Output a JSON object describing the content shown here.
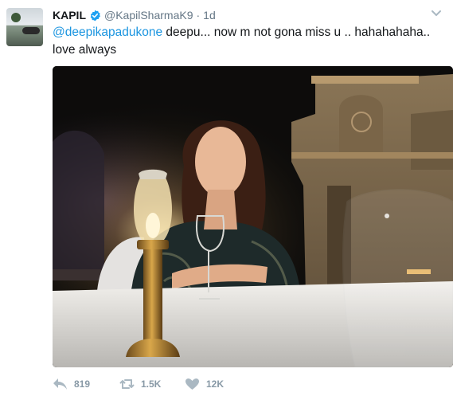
{
  "tweet": {
    "display_name": "KAPIL",
    "handle": "@KapilSharmaK9",
    "separator": "·",
    "time": "1d",
    "mention": "@deepikapadukone",
    "body": " deepu... now m not gona miss u .. hahahahaha.. love always",
    "verified_color": "#1da1f2",
    "link_color": "#1b95e0"
  },
  "actions": {
    "replies": "819",
    "retweets": "1.5K",
    "likes": "12K"
  },
  "icons": {
    "reply": "reply-icon",
    "retweet": "retweet-icon",
    "like": "heart-icon",
    "verified": "verified-badge-icon",
    "menu": "chevron-down-icon"
  }
}
